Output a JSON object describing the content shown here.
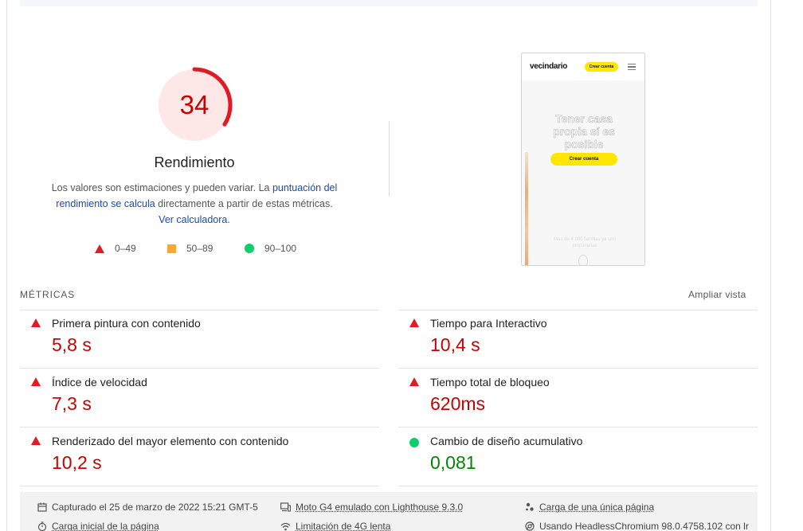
{
  "score": {
    "value": "34",
    "fraction": 0.34,
    "title": "Rendimiento",
    "color": "#e01b24",
    "track_color": "#fde7e7"
  },
  "description": {
    "text_1": "Los valores son estimaciones y pueden variar. La ",
    "link_1": "puntuación del rendimiento se calcula",
    "text_2": " directamente a partir de estas métricas. ",
    "link_2": "Ver calculadora",
    "text_3": "."
  },
  "legend": [
    {
      "shape": "triangle",
      "label": "0–49",
      "color": "#e01b24"
    },
    {
      "shape": "square",
      "label": "50–89",
      "color": "#f6a833"
    },
    {
      "shape": "circle",
      "label": "90–100",
      "color": "#0cce6b"
    }
  ],
  "screenshot": {
    "logo": "vecindario",
    "cta_small": "Crear cuenta",
    "headline": "Tener casa propia sí es posible",
    "cta": "Crear cuenta",
    "small_text": "Más de 4.000 familias ya son propietarias"
  },
  "metrics": {
    "header": "MÉTRICAS",
    "expand": "Ampliar vista",
    "items": [
      {
        "label": "Primera pintura con contenido",
        "value": "5,8 s",
        "status": "fail"
      },
      {
        "label": "Tiempo para Interactivo",
        "value": "10,4 s",
        "status": "fail"
      },
      {
        "label": "Índice de velocidad",
        "value": "7,3 s",
        "status": "fail"
      },
      {
        "label": "Tiempo total de bloqueo",
        "value": "620ms",
        "status": "fail"
      },
      {
        "label": "Renderizado del mayor elemento con contenido",
        "value": "10,2 s",
        "status": "fail"
      },
      {
        "label": "Cambio de diseño acumulativo",
        "value": "0,081",
        "status": "pass"
      }
    ]
  },
  "footer": {
    "captured": "Capturado el 25 de marzo de 2022 15:21 GMT-5",
    "device": "Moto G4 emulado con Lighthouse 9.3.0",
    "session": "Carga de una única página",
    "initial_load": "Carga inicial de la página",
    "throttling": "Limitación de 4G lenta",
    "browser": "Usando HeadlessChromium 98.0.4758.102 con lr"
  }
}
